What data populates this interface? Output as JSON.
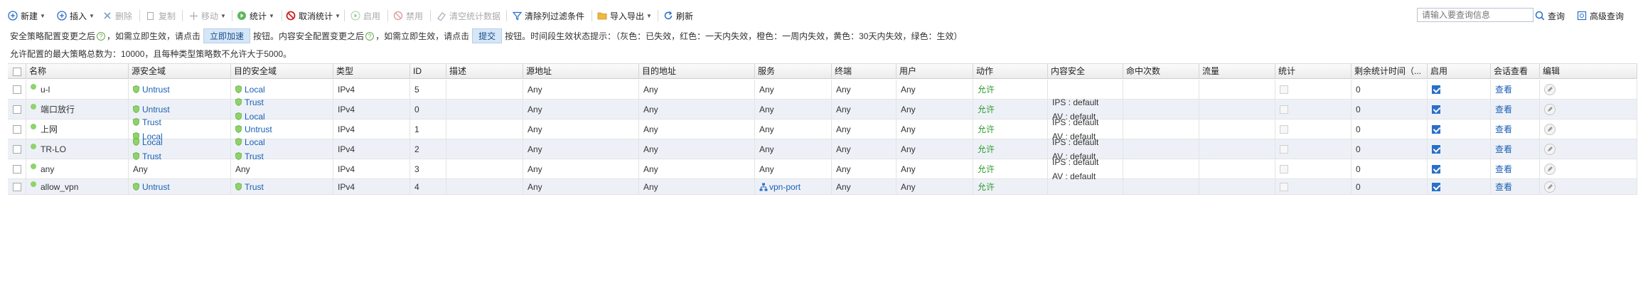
{
  "toolbar": {
    "new": "新建",
    "insert": "插入",
    "delete": "删除",
    "copy": "复制",
    "move": "移动",
    "stats": "统计",
    "cancel_stats": "取消统计",
    "enable": "启用",
    "disable": "禁用",
    "clear_stats": "清空统计数据",
    "clear_filters": "清除列过滤条件",
    "import_export": "导入导出",
    "refresh": "刷新",
    "search_placeholder": "请输入要查询信息",
    "query": "查询",
    "advanced_query": "高级查询"
  },
  "hint": {
    "p1": "安全策略配置变更之后",
    "p2": "，如需立即生效，请点击",
    "btn1": "立即加速",
    "p3": "按钮。内容安全配置变更之后",
    "p4": "，如需立即生效，请点击",
    "btn2": "提交",
    "p5": "按钮。时间段生效状态提示：（灰色：已失效，红色：一天内失效，橙色：一周内失效，黄色：30天内失效，绿色：生效）",
    "max": "允许配置的最大策略总数为：10000，且每种类型策略数不允许大于5000。"
  },
  "columns": {
    "name": "名称",
    "src_zone": "源安全域",
    "dst_zone": "目的安全域",
    "type": "类型",
    "id": "ID",
    "desc": "描述",
    "src_addr": "源地址",
    "dst_addr": "目的地址",
    "service": "服务",
    "terminal": "终端",
    "user": "用户",
    "action": "动作",
    "content": "内容安全",
    "hits": "命中次数",
    "traffic": "流量",
    "stats": "统计",
    "remain": "剩余统计时间（...",
    "enable": "启用",
    "session": "会话查看",
    "edit": "编辑"
  },
  "rows": [
    {
      "name": "u-l",
      "src": [
        "Untrust"
      ],
      "dst": [
        "Local"
      ],
      "type": "IPv4",
      "id": "5",
      "src_addr": "Any",
      "dst_addr": "Any",
      "service": "Any",
      "terminal": "Any",
      "user": "Any",
      "action": "允许",
      "content": [],
      "remain": "0",
      "view": "查看"
    },
    {
      "name": "端口放行",
      "src": [
        "Untrust"
      ],
      "dst": [
        "Trust",
        "Local"
      ],
      "type": "IPv4",
      "id": "0",
      "src_addr": "Any",
      "dst_addr": "Any",
      "service": "Any",
      "terminal": "Any",
      "user": "Any",
      "action": "允许",
      "content": [
        "IPS : default",
        "AV : default"
      ],
      "remain": "0",
      "view": "查看"
    },
    {
      "name": "上网",
      "src": [
        "Trust",
        "Local"
      ],
      "dst": [
        "Untrust"
      ],
      "type": "IPv4",
      "id": "1",
      "src_addr": "Any",
      "dst_addr": "Any",
      "service": "Any",
      "terminal": "Any",
      "user": "Any",
      "action": "允许",
      "content": [
        "IPS : default",
        "AV : default"
      ],
      "remain": "0",
      "view": "查看"
    },
    {
      "name": "TR-LO",
      "src": [
        "Local",
        "Trust"
      ],
      "dst": [
        "Local",
        "Trust"
      ],
      "type": "IPv4",
      "id": "2",
      "src_addr": "Any",
      "dst_addr": "Any",
      "service": "Any",
      "terminal": "Any",
      "user": "Any",
      "action": "允许",
      "content": [
        "IPS : default",
        "AV : default"
      ],
      "remain": "0",
      "view": "查看"
    },
    {
      "name": "any",
      "src_plain": "Any",
      "dst_plain": "Any",
      "src": [],
      "dst": [],
      "type": "IPv4",
      "id": "3",
      "src_addr": "Any",
      "dst_addr": "Any",
      "service": "Any",
      "terminal": "Any",
      "user": "Any",
      "action": "允许",
      "content": [
        "IPS : default",
        "AV : default"
      ],
      "remain": "0",
      "view": "查看"
    },
    {
      "name": "allow_vpn",
      "src": [
        "Untrust"
      ],
      "dst": [
        "Trust"
      ],
      "type": "IPv4",
      "id": "4",
      "src_addr": "Any",
      "dst_addr": "Any",
      "service": "vpn-port",
      "service_icon": "network-object-icon",
      "terminal": "Any",
      "user": "Any",
      "action": "允许",
      "content": [],
      "remain": "0",
      "view": "查看"
    }
  ],
  "colors": {
    "zone": "#1a5fb4",
    "action": "#2f9b2f",
    "enabled_dot": "#8fd36a",
    "alt_row": "#edf1f7"
  }
}
